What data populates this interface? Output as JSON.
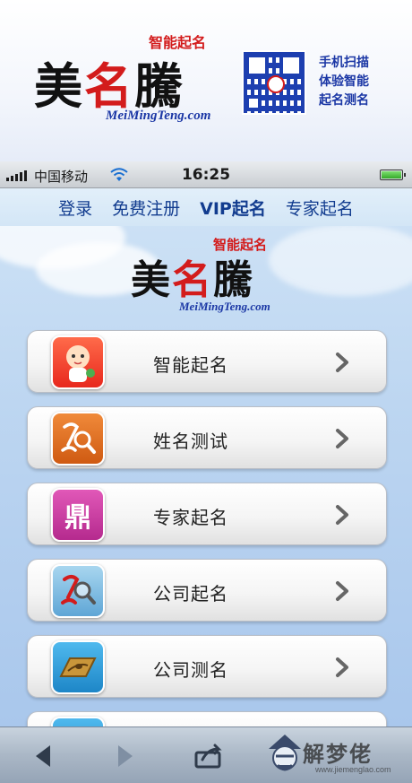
{
  "banner": {
    "logo_left": "美",
    "logo_mid": "名",
    "logo_right": "騰",
    "slogan": "智能起名",
    "url": "MeiMingTeng.com",
    "tagline": [
      "手机扫描",
      "体验智能",
      "起名测名"
    ]
  },
  "statusbar": {
    "carrier": "中国移动",
    "time": "16:25"
  },
  "topnav": {
    "items": [
      {
        "label": "登录"
      },
      {
        "label": "免费注册"
      },
      {
        "label": "VIP起名"
      },
      {
        "label": "专家起名"
      }
    ]
  },
  "hero": {
    "logo_left": "美",
    "logo_mid": "名",
    "logo_right": "騰",
    "slogan": "智能起名",
    "url": "MeiMingTeng.com"
  },
  "menu": {
    "items": [
      {
        "label": "智能起名",
        "icon": "baby-icon"
      },
      {
        "label": "姓名测试",
        "icon": "name-magnifier-icon"
      },
      {
        "label": "专家起名",
        "icon": "expert-icon",
        "glyph": "鼎"
      },
      {
        "label": "公司起名",
        "icon": "company-name-icon"
      },
      {
        "label": "公司测名",
        "icon": "company-test-icon"
      }
    ]
  },
  "watermark": {
    "text": "解梦佬",
    "url": "www.jiemenglao.com"
  },
  "colors": {
    "brand_red": "#d31c1c",
    "brand_blue": "#1b37a5",
    "nav_blue": "#123c8f"
  }
}
